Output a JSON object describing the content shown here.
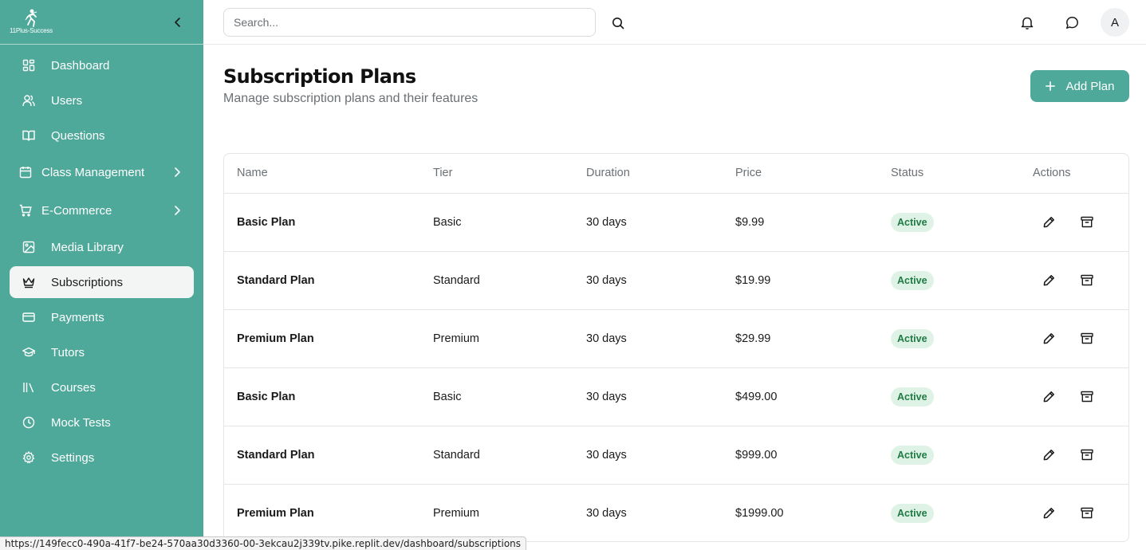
{
  "brand": {
    "name": "11Plus-Success"
  },
  "sidebar": {
    "items": [
      {
        "label": "Dashboard",
        "icon": "grid-icon"
      },
      {
        "label": "Users",
        "icon": "users-icon"
      },
      {
        "label": "Questions",
        "icon": "book-icon"
      },
      {
        "label": "Class Management",
        "icon": "calendar-icon",
        "expandable": true
      },
      {
        "label": "E-Commerce",
        "icon": "cart-icon",
        "expandable": true
      },
      {
        "label": "Media Library",
        "icon": "image-icon"
      },
      {
        "label": "Subscriptions",
        "icon": "crown-icon",
        "active": true
      },
      {
        "label": "Payments",
        "icon": "credit-card-icon"
      },
      {
        "label": "Tutors",
        "icon": "graduation-cap-icon"
      },
      {
        "label": "Courses",
        "icon": "library-icon"
      },
      {
        "label": "Mock Tests",
        "icon": "clock-icon"
      },
      {
        "label": "Settings",
        "icon": "gear-icon"
      }
    ]
  },
  "topbar": {
    "search_placeholder": "Search...",
    "avatar_initial": "A"
  },
  "page": {
    "title": "Subscription Plans",
    "subtitle": "Manage subscription plans and their features",
    "add_button_label": "Add Plan"
  },
  "table": {
    "columns": [
      "Name",
      "Tier",
      "Duration",
      "Price",
      "Status",
      "Actions"
    ],
    "rows": [
      {
        "name": "Basic Plan",
        "tier": "Basic",
        "duration": "30 days",
        "price": "$9.99",
        "status": "Active"
      },
      {
        "name": "Standard Plan",
        "tier": "Standard",
        "duration": "30 days",
        "price": "$19.99",
        "status": "Active"
      },
      {
        "name": "Premium Plan",
        "tier": "Premium",
        "duration": "30 days",
        "price": "$29.99",
        "status": "Active"
      },
      {
        "name": "Basic Plan",
        "tier": "Basic",
        "duration": "30 days",
        "price": "$499.00",
        "status": "Active"
      },
      {
        "name": "Standard Plan",
        "tier": "Standard",
        "duration": "30 days",
        "price": "$999.00",
        "status": "Active"
      },
      {
        "name": "Premium Plan",
        "tier": "Premium",
        "duration": "30 days",
        "price": "$1999.00",
        "status": "Active"
      }
    ]
  },
  "status_bar": {
    "url": "https://149fecc0-490a-41f7-be24-570aa30d3360-00-3ekcau2j339tv.pike.replit.dev/dashboard/subscriptions"
  },
  "colors": {
    "accent": "#4fa99a",
    "active_badge_bg": "#def3e6",
    "active_badge_text": "#1f7a44"
  }
}
